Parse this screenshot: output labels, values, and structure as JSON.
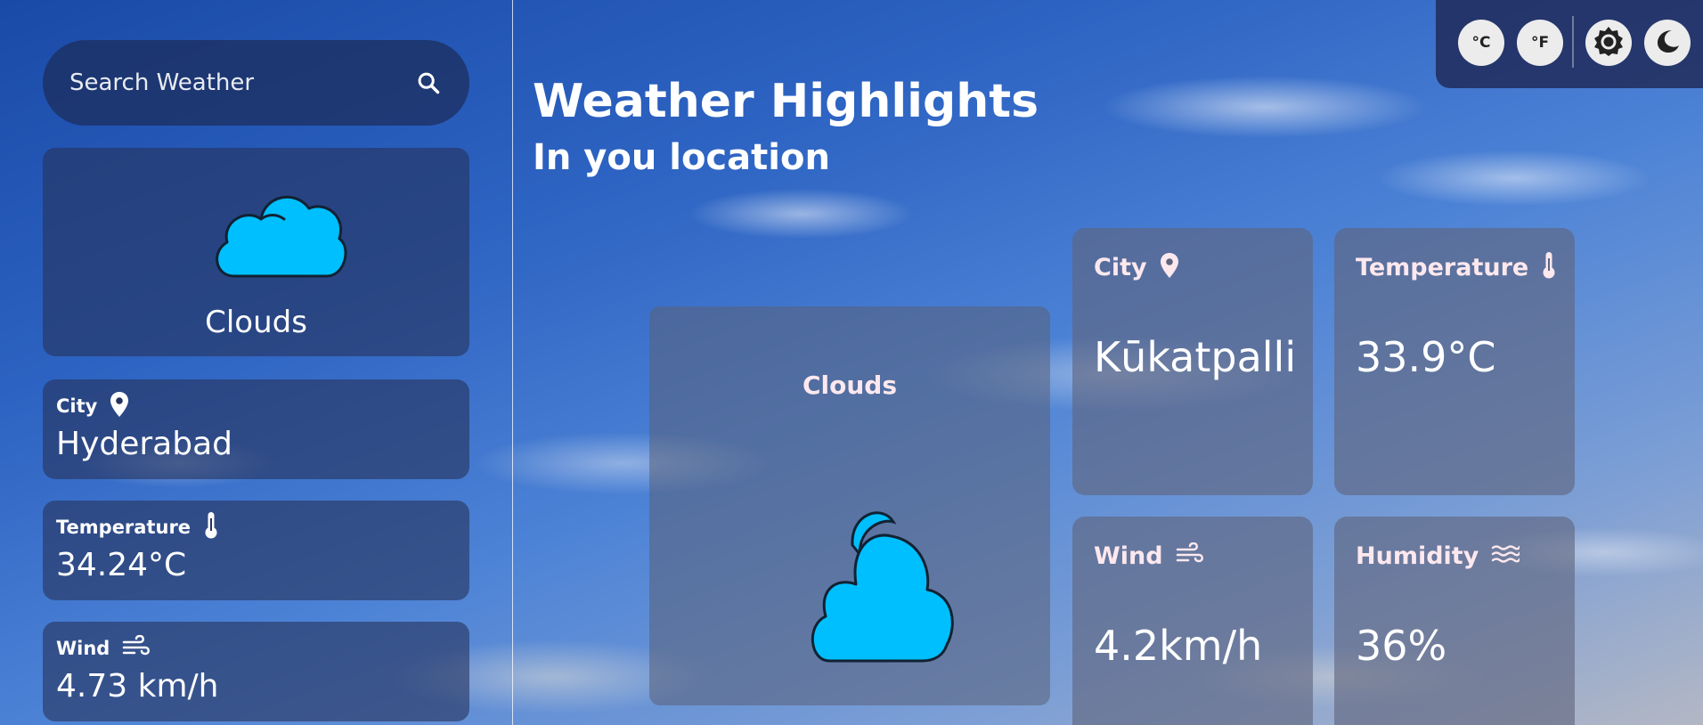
{
  "search": {
    "placeholder": "Search Weather"
  },
  "sidebar": {
    "condition": "Clouds",
    "city": {
      "label": "City",
      "value": "Hyderabad"
    },
    "temperature": {
      "label": "Temperature",
      "value": "34.24°C"
    },
    "wind": {
      "label": "Wind",
      "value": "4.73 km/h"
    }
  },
  "main": {
    "title": "Weather Highlights",
    "subtitle": "In you location",
    "condition": "Clouds",
    "cards": {
      "city": {
        "label": "City",
        "value": "Kūkatpalli"
      },
      "temperature": {
        "label": "Temperature",
        "value": "33.9°C"
      },
      "wind": {
        "label": "Wind",
        "value": "4.2km/h"
      },
      "humidity": {
        "label": "Humidity",
        "value": "36%"
      }
    }
  },
  "toolbar": {
    "celsius_label": "°C",
    "fahrenheit_label": "°F",
    "light_mode_icon": "sun-icon",
    "dark_mode_icon": "moon-icon"
  },
  "colors": {
    "cloud_fill": "#00bfff",
    "card_bg_dark": "#26325a",
    "toolbar_bg": "#1e2856",
    "label_pink": "#fde8ee"
  }
}
